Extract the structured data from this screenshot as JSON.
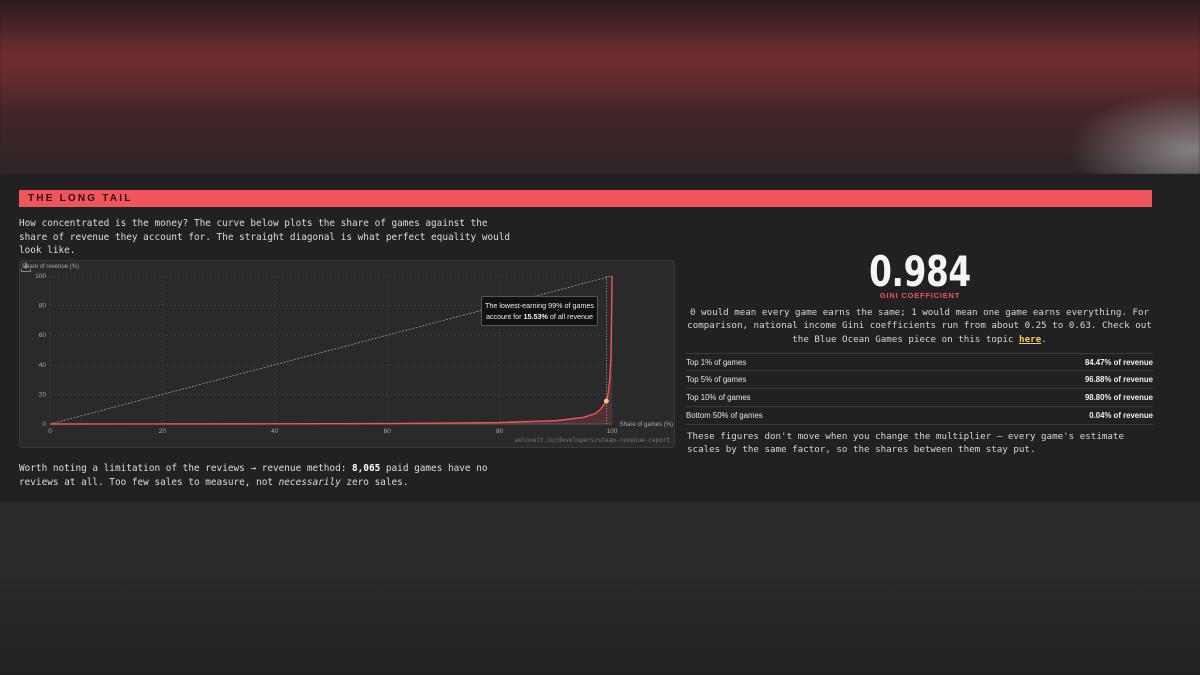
{
  "section": {
    "banner": "THE LONG TAIL",
    "intro": "How concentrated is the money? The curve below plots the share of games against the share of revenue they account for. The straight diagonal is what perfect equality would look like."
  },
  "chart_data": {
    "type": "line",
    "ylabel": "Share of revenue (%)",
    "xlabel": "Share of games (%)",
    "xlim": [
      0,
      100
    ],
    "ylim": [
      0,
      100
    ],
    "x_ticks": [
      "0",
      "20",
      "40",
      "60",
      "80",
      "100"
    ],
    "y_ticks": [
      "0",
      "20",
      "40",
      "60",
      "80",
      "100"
    ],
    "grid": true,
    "series": [
      {
        "x": [
          0,
          20,
          40,
          60,
          80,
          90,
          95,
          97,
          98,
          99,
          99.3,
          99.6,
          99.8,
          99.9,
          100
        ],
        "y": [
          0,
          0.02,
          0.1,
          0.3,
          1.0,
          2.2,
          4.5,
          7.0,
          10.0,
          15.53,
          20,
          30,
          45,
          65,
          100
        ]
      },
      {
        "x": [
          0,
          100
        ],
        "y": [
          0,
          100
        ]
      }
    ],
    "highlight": {
      "x": 99,
      "y": 15.53
    },
    "tooltip": {
      "line1": "The lowest-earning 99% of games",
      "line2_prefix": "account for ",
      "line2_value": "15.53%",
      "line2_suffix": " of all revenue"
    },
    "watermark": "weloveit.io/developers/steam-revenue-report",
    "colors": {
      "curve": "#f0555c",
      "diagonal": "#9a9a9a",
      "point": "#f4c96b"
    }
  },
  "note": {
    "prefix": "Worth noting a limitation of the reviews → revenue method: ",
    "count": "8,065",
    "middle": " paid games have no reviews at all. Too few sales to measure, not ",
    "emphasis": "necessarily",
    "suffix": " zero sales."
  },
  "gini": {
    "value": "0.984",
    "label": "GINI COEFFICIENT",
    "description": "0 would mean every game earns the same; 1 would mean one game earns everything. For comparison, national income Gini coefficients run from about 0.25 to 0.63. Check out the Blue Ocean Games piece on this topic ",
    "link_text": "here",
    "description_end": "."
  },
  "stats": [
    {
      "label": "Top 1% of games",
      "value": "84.47% of revenue"
    },
    {
      "label": "Top 5% of games",
      "value": "96.88% of revenue"
    },
    {
      "label": "Top 10% of games",
      "value": "98.80% of revenue"
    },
    {
      "label": "Bottom 50% of games",
      "value": "0.04% of revenue"
    }
  ],
  "closing": "These figures don't move when you change the multiplier — every game's estimate scales by the same factor, so the shares between them stay put.",
  "colors": {
    "accent": "#f0555c",
    "link": "#f4c96b",
    "background": "#212121"
  }
}
